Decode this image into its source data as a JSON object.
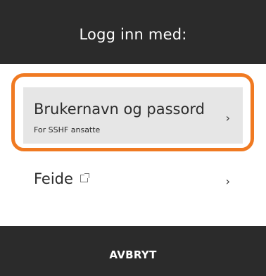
{
  "header": {
    "title": "Logg inn med:"
  },
  "options": [
    {
      "title": "Brukernavn og passord",
      "subtitle": "For SSHF ansatte",
      "chevron": "›",
      "icon": "chevron-right-icon"
    },
    {
      "title": "Feide",
      "chevron": "›",
      "icon": "external-link-icon"
    }
  ],
  "footer": {
    "cancel_label": "AVBRYT"
  },
  "colors": {
    "header_bg": "#2b2b2b",
    "highlight": "#f07a22",
    "item_bg": "#e6e6e6"
  }
}
